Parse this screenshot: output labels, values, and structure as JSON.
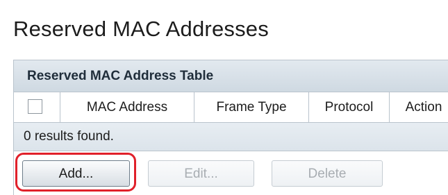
{
  "page": {
    "title": "Reserved MAC Addresses"
  },
  "table": {
    "caption": "Reserved MAC Address Table",
    "columns": [
      "MAC Address",
      "Frame Type",
      "Protocol",
      "Action"
    ],
    "select_all_checked": false,
    "results_text": "0 results found.",
    "rows": []
  },
  "buttons": {
    "add_label": "Add...",
    "add_enabled": true,
    "edit_label": "Edit...",
    "edit_enabled": false,
    "delete_label": "Delete",
    "delete_enabled": false
  },
  "annotation": {
    "highlight_target": "add-button",
    "highlight_color": "#e0202a"
  }
}
